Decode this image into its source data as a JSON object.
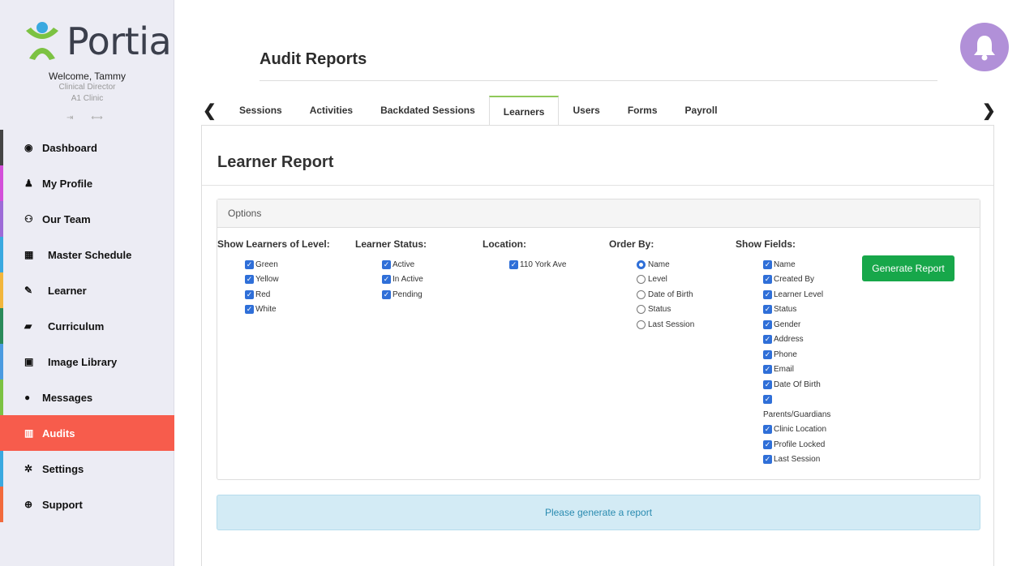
{
  "brand": {
    "name": "Portia",
    "color": "#7cc242",
    "dot_color": "#3aa9e0"
  },
  "user": {
    "welcome": "Welcome, Tammy",
    "role": "Clinical Director",
    "clinic": "A1 Clinic"
  },
  "sidebar": {
    "items": [
      {
        "label": "Dashboard",
        "icon": "dashboard-icon",
        "glyph": "◉",
        "accent": "#444444"
      },
      {
        "label": "My Profile",
        "icon": "user-icon",
        "glyph": "♟",
        "accent": "#d34fd9"
      },
      {
        "label": "Our Team",
        "icon": "team-icon",
        "glyph": "⚇",
        "accent": "#9d6bd7"
      },
      {
        "label": "Master Schedule",
        "icon": "calendar-icon",
        "glyph": "▦",
        "accent": "#3aa9e0"
      },
      {
        "label": "Learner",
        "icon": "pencil-icon",
        "glyph": "✎",
        "accent": "#f2b63c"
      },
      {
        "label": "Curriculum",
        "icon": "book-icon",
        "glyph": "▰",
        "accent": "#2a8a5a"
      },
      {
        "label": "Image Library",
        "icon": "image-icon",
        "glyph": "▣",
        "accent": "#4b9be0"
      },
      {
        "label": "Messages",
        "icon": "chat-icon",
        "glyph": "●",
        "accent": "#7cc242"
      },
      {
        "label": "Audits",
        "icon": "bar-chart-icon",
        "glyph": "▥",
        "accent": "#f75c4c",
        "active": true
      },
      {
        "label": "Settings",
        "icon": "gear-icon",
        "glyph": "✲",
        "accent": "#3aa9e0"
      },
      {
        "label": "Support",
        "icon": "lifebuoy-icon",
        "glyph": "⊕",
        "accent": "#f26a3c"
      }
    ]
  },
  "header": {
    "title": "Audit Reports"
  },
  "tabs": [
    "Sessions",
    "Activities",
    "Backdated Sessions",
    "Learners",
    "Users",
    "Forms",
    "Payroll"
  ],
  "active_tab": "Learners",
  "report": {
    "title": "Learner Report",
    "options_label": "Options",
    "levels": {
      "title": "Show Learners of Level:",
      "options": [
        "Green",
        "Yellow",
        "Red",
        "White"
      ]
    },
    "status": {
      "title": "Learner Status:",
      "options": [
        "Active",
        "In Active",
        "Pending"
      ]
    },
    "location": {
      "title": "Location:",
      "options": [
        "110 York Ave"
      ]
    },
    "order_by": {
      "title": "Order By:",
      "options": [
        "Name",
        "Level",
        "Date of Birth",
        "Status",
        "Last Session"
      ],
      "selected": "Name"
    },
    "fields": {
      "title": "Show Fields:",
      "options": [
        "Name",
        "Created By",
        "Learner Level",
        "Status",
        "Gender",
        "Address",
        "Phone",
        "Email",
        "Date Of Birth",
        "",
        "Parents/Guardians",
        "Clinic Location",
        "Profile Locked",
        "Last Session"
      ]
    },
    "generate_label": "Generate Report",
    "generate_color": "#17a74a",
    "message": "Please generate a report"
  }
}
